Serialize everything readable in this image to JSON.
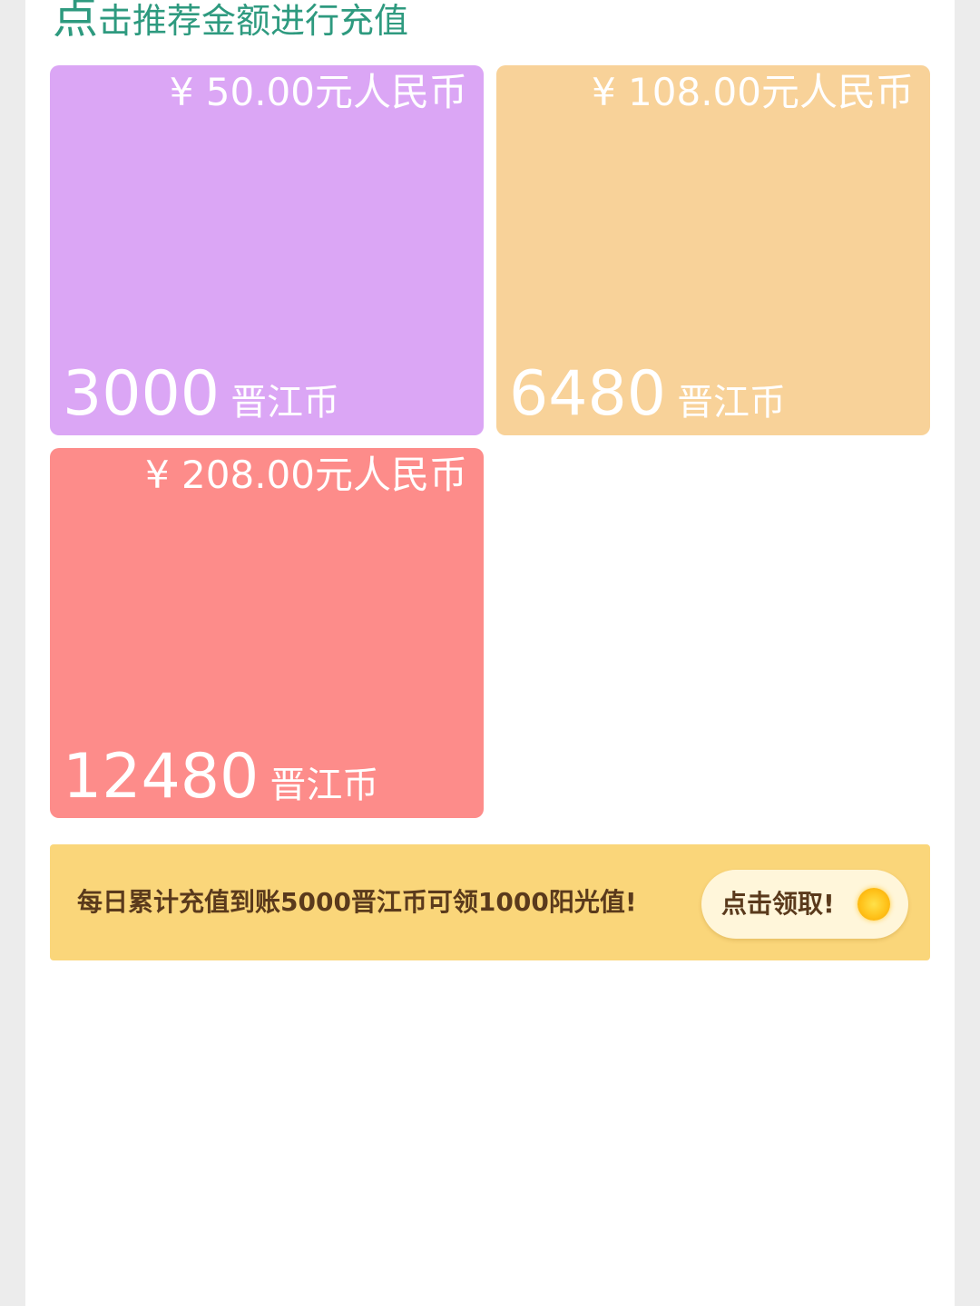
{
  "header": {
    "title_first": "点",
    "title_rest": "击推荐金额进行充值"
  },
  "packages": [
    {
      "price": "¥ 50.00元人民币",
      "amount": "3000",
      "unit": "晋江币",
      "color": "#dba6f5"
    },
    {
      "price": "¥ 108.00元人民币",
      "amount": "6480",
      "unit": "晋江币",
      "color": "#f8d299"
    },
    {
      "price": "¥ 208.00元人民币",
      "amount": "12480",
      "unit": "晋江币",
      "color": "#fd8c8a"
    }
  ],
  "promo": {
    "text": "每日累计充值到账5000晋江币可领1000阳光值!",
    "button_label": "点击领取!",
    "button_icon": "sun-coin-icon",
    "background": "#fad67a"
  }
}
